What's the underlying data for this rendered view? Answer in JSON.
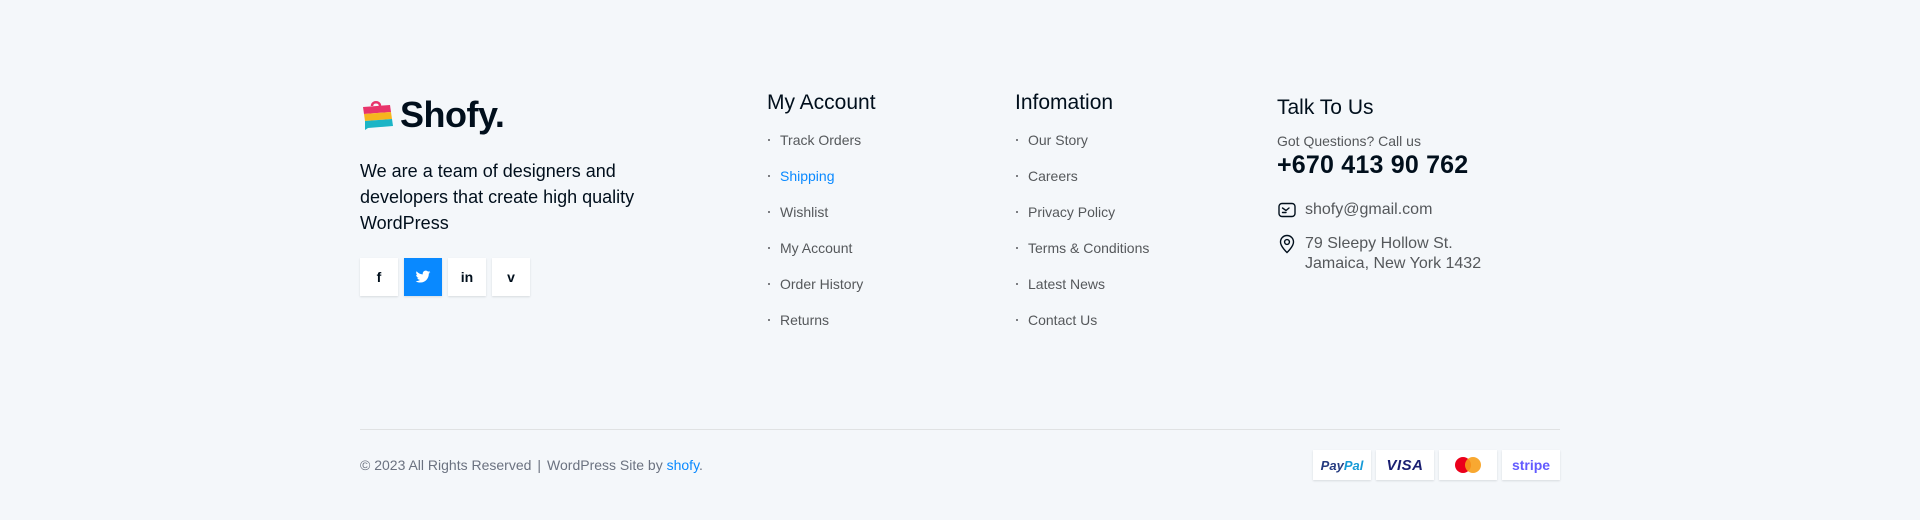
{
  "brand": {
    "name": "Shofy.",
    "about": "We are a team of designers and developers that create high quality WordPress"
  },
  "socials": [
    {
      "icon": "facebook-icon",
      "glyph": "f"
    },
    {
      "icon": "twitter-icon"
    },
    {
      "icon": "linkedin-icon",
      "glyph": "in"
    },
    {
      "icon": "vimeo-icon",
      "glyph": "v"
    }
  ],
  "account": {
    "title": "My Account",
    "links": [
      "Track Orders",
      "Shipping",
      "Wishlist",
      "My Account",
      "Order History",
      "Returns"
    ]
  },
  "information": {
    "title": "Infomation",
    "links": [
      "Our Story",
      "Careers",
      "Privacy Policy",
      "Terms & Conditions",
      "Latest News",
      "Contact Us"
    ]
  },
  "talk": {
    "title": "Talk To Us",
    "subtitle": "Got Questions? Call us",
    "phone": "+670 413 90 762",
    "email": "shofy@gmail.com",
    "address_line1": "79 Sleepy Hollow St.",
    "address_line2": "Jamaica, New York 1432"
  },
  "bottom": {
    "copyright": "© 2023 All Rights Reserved",
    "separator": "|",
    "site_by": "WordPress Site by",
    "link": "shofy",
    "period": "."
  },
  "payments": {
    "paypal_a": "Pay",
    "paypal_b": "Pal",
    "visa": "VISA",
    "stripe": "stripe"
  },
  "colors": {
    "background": "#f4f7fa",
    "accent": "#0989ff",
    "text": "#010f1c",
    "muted": "#55585b"
  }
}
